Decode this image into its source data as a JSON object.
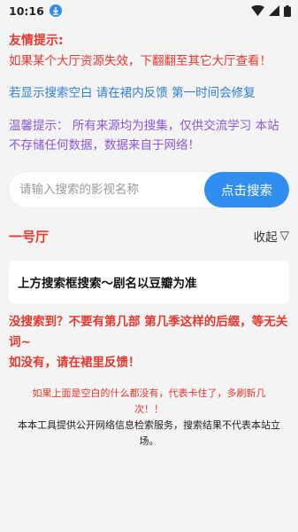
{
  "status_bar": {
    "time": "10:16"
  },
  "notices": {
    "title": "友情提示:",
    "line1": "如果某个大厅资源失效，下翻翻至其它大厅查看！",
    "line2": "若显示搜索空白 请在裙内反馈 第一时间会修复",
    "line3": "温馨提示：  所有来源均为搜集，仅供交流学习 本站不存储任何数据，数据来自于网络！"
  },
  "search": {
    "placeholder": "请输入搜索的影视名称",
    "button_label": "点击搜索"
  },
  "section": {
    "title": "一号厅",
    "collapse_label": "收起",
    "collapse_icon": "▽"
  },
  "result": {
    "text": "上方搜索框搜索～剧名以豆瓣为准"
  },
  "tips": {
    "line1": "没搜索到？不要有第几部 第几季这样的后缀，等无关词~",
    "line2": "如没有，请在裙里反馈！"
  },
  "footer": {
    "red_text": "如果上面是空白的什么都没有，代表卡住了，多刷新几次！！",
    "disclaimer": "本本工具提供公开网络信息检索服务，搜索结果不代表本站立场。"
  },
  "colors": {
    "accent_red": "#e8382e",
    "accent_blue": "#2f8ef0",
    "purple": "#8a58e0"
  }
}
